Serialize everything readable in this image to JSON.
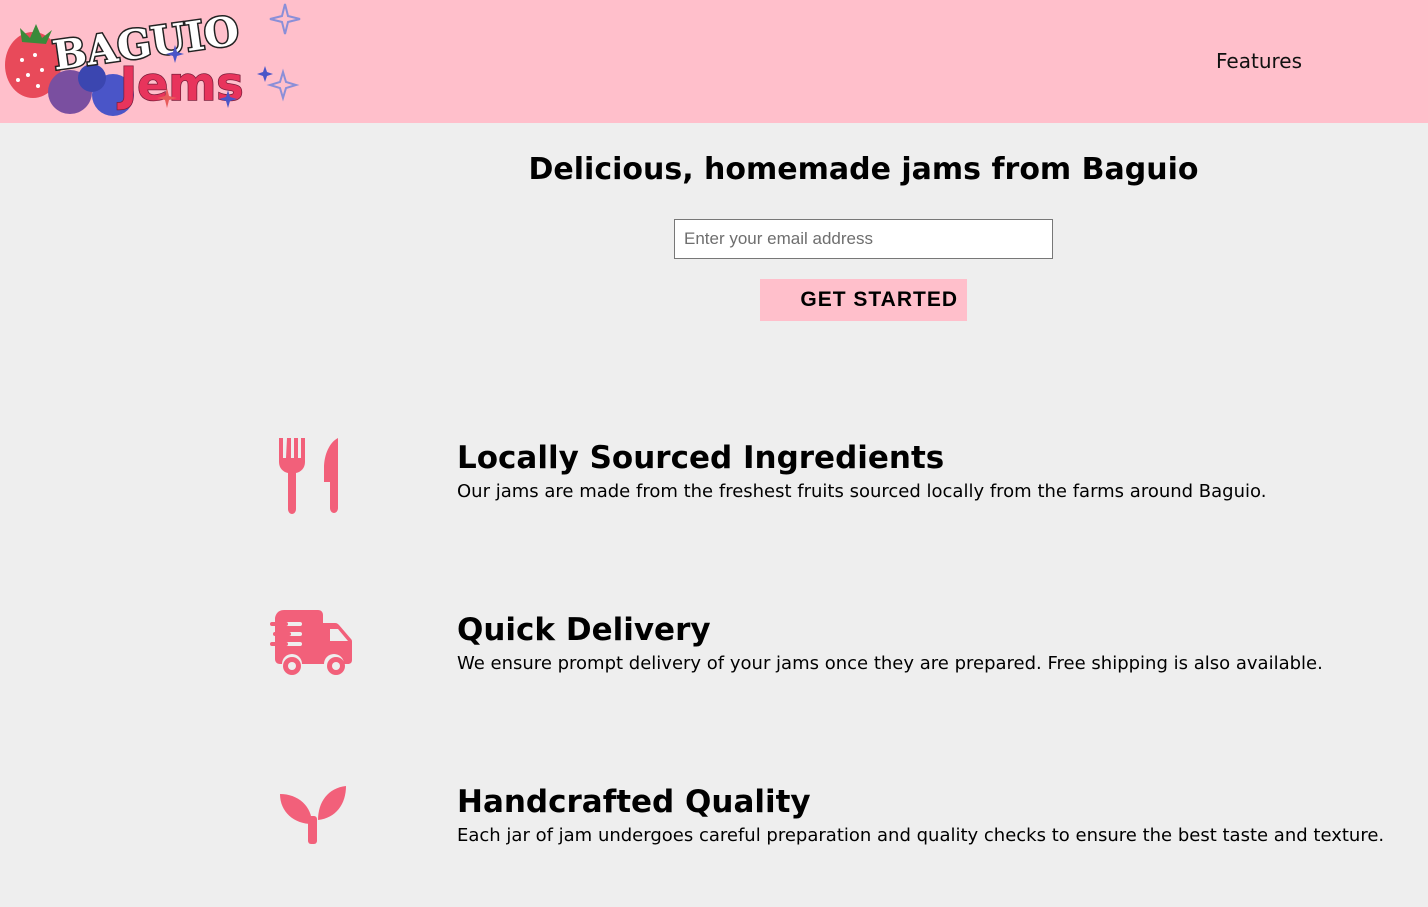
{
  "header": {
    "logo_text_top": "BAGUIO",
    "logo_text_bottom": "Jems",
    "nav": [
      {
        "label": "Features"
      }
    ]
  },
  "hero": {
    "title": "Delicious, homemade jams from Baguio",
    "email_placeholder": "Enter your email address",
    "cta_label": "GET STARTED"
  },
  "features": [
    {
      "icon": "utensils-icon",
      "title": "Locally Sourced Ingredients",
      "description": "Our jams are made from the freshest fruits sourced locally from the farms around Baguio."
    },
    {
      "icon": "truck-fast-icon",
      "title": "Quick Delivery",
      "description": "We ensure prompt delivery of your jams once they are prepared. Free shipping is also available."
    },
    {
      "icon": "seedling-icon",
      "title": "Handcrafted Quality",
      "description": "Each jar of jam undergoes careful preparation and quality checks to ensure the best taste and texture."
    }
  ],
  "colors": {
    "header_bg": "#ffbfcb",
    "page_bg": "#eeeeee",
    "icon_color": "#f2607a",
    "button_bg": "#ffbfcb"
  }
}
